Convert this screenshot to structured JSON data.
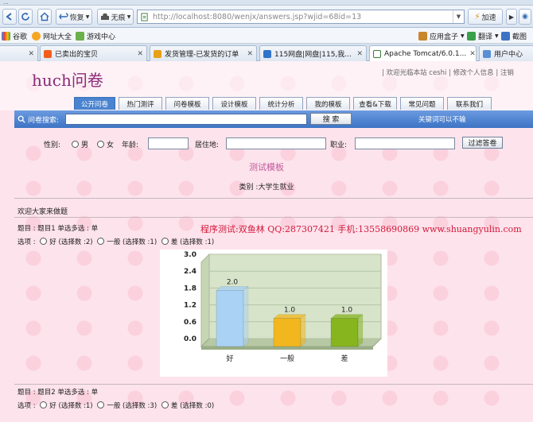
{
  "browser": {
    "top_strip_text": "...",
    "nav": {
      "back": "",
      "refresh": "",
      "home": "",
      "restore_label": "恢复",
      "ad_label": "无痕"
    },
    "address_url": "http://localhost:8080/wenjx/answers.jsp?wjid=68id=13",
    "accelerate_label": "加速",
    "bookmarks": [
      "谷歌",
      "网址大全",
      "游戏中心"
    ],
    "bookmarks_right": [
      "应用盒子",
      "翻译",
      "截图"
    ],
    "tabs": [
      {
        "title": "已卖出的宝贝",
        "active": false
      },
      {
        "title": "发货管理-已发货的订单",
        "active": false
      },
      {
        "title": "115网盘|网盘|115,我...",
        "active": false
      },
      {
        "title": "Apache Tomcat/6.0.1...",
        "active": true
      },
      {
        "title": "用户中心",
        "active": false
      }
    ]
  },
  "site": {
    "logo": "huch问卷",
    "top_links": "| 欢迎光临本站 ceshi | 修改个人信息 | 注销",
    "nav": [
      "公开问卷",
      "热门测评",
      "问卷模板",
      "设计模板",
      "统计分析",
      "我的模板",
      "查看&下载",
      "常见问题",
      "联系我们"
    ],
    "nav_active": 0,
    "search": {
      "label": "问卷搜索:",
      "value": "",
      "button": "搜  索",
      "hot_words": "关键词可以不输"
    },
    "filters": {
      "gender_label": "性别:",
      "male": "男",
      "female": "女",
      "age_label": "年龄:",
      "residence_label": "居住地:",
      "job_label": "职业:",
      "button": "过滤答卷"
    }
  },
  "survey": {
    "template_title": "测试模板",
    "category": "类别 :大学生就业",
    "welcome": "欢迎大家来做题",
    "watermark": "程序测试:双鱼林 QQ:287307421 手机:13558690869 www.shuangyulin.com",
    "questions": [
      {
        "title": "题目 : 题目1 单选多选 : 单",
        "options_label": "选项 :",
        "options": [
          {
            "name": "好",
            "count_text": "(选择数 :2)"
          },
          {
            "name": "一般",
            "count_text": "(选择数 :1)"
          },
          {
            "name": "差",
            "count_text": "(选择数 :1)"
          }
        ]
      },
      {
        "title": "题目 : 题目2 单选多选 : 单",
        "options_label": "选项 :",
        "options": [
          {
            "name": "好",
            "count_text": "(选择数 :1)"
          },
          {
            "name": "一般",
            "count_text": "(选择数 :3)"
          },
          {
            "name": "差",
            "count_text": "(选择数 :0)"
          }
        ]
      }
    ]
  },
  "chart_data": {
    "type": "bar",
    "categories": [
      "好",
      "一般",
      "差"
    ],
    "values": [
      2.0,
      1.0,
      1.0
    ],
    "value_labels": [
      "2.0",
      "1.0",
      "1.0"
    ],
    "yticks": [
      "0.0",
      "0.6",
      "1.2",
      "1.8",
      "2.4",
      "3.0"
    ],
    "ylim": [
      0,
      3.0
    ],
    "colors": [
      "#a9d2f5",
      "#f2b71f",
      "#86b51d"
    ],
    "grid": true
  }
}
